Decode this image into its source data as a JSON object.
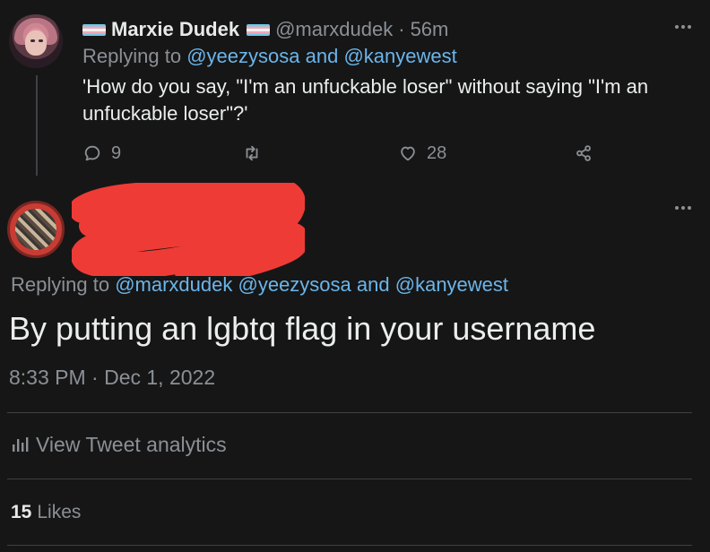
{
  "parent_tweet": {
    "display_name": "Marxie Dudek",
    "handle": "@marxdudek",
    "separator": "·",
    "time": "56m",
    "replying_prefix": "Replying to",
    "mention_1": "@yeezysosa",
    "conjunction": "and",
    "mention_2": "@kanyewest",
    "text": "'How do you say, \"I'm an unfuckable loser\" without saying \"I'm an unfuckable loser\"?'",
    "reply_count": "9",
    "retweet_count": "",
    "like_count": "28",
    "icons": [
      "reply-icon",
      "retweet-icon",
      "like-icon",
      "share-icon",
      "more-icon"
    ]
  },
  "main_tweet": {
    "replying_prefix": "Replying to",
    "mention_1": "@marxdudek",
    "mention_2": "@yeezysosa",
    "conjunction": "and",
    "mention_3": "@kanyewest",
    "text": "By putting an lgbtq flag in your username",
    "timestamp": "8:33 PM · Dec 1, 2022",
    "analytics_label": "View Tweet analytics",
    "likes_count": "15",
    "likes_label": "Likes"
  },
  "colors": {
    "background": "#161616",
    "text": "#e7e9ea",
    "muted": "#8b9096",
    "link": "#6bb5ea",
    "redaction": "#ee3b36",
    "divider": "#3e4144"
  }
}
